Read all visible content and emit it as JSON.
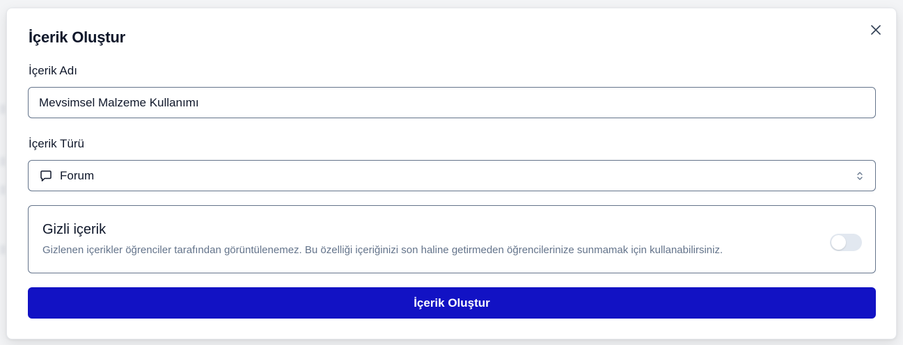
{
  "modal": {
    "title": "İçerik Oluştur",
    "close_icon": "close-icon"
  },
  "form": {
    "name_label": "İçerik Adı",
    "name_value": "Mevsimsel Malzeme Kullanımı",
    "type_label": "İçerik Türü",
    "type_value": "Forum",
    "type_icon": "message-square-icon",
    "type_chevron_icon": "chevrons-up-down-icon"
  },
  "hidden_content": {
    "title": "Gizli içerik",
    "description": "Gizlenen içerikler öğrenciler tarafından görüntülenemez. Bu özelliği içeriğinizi son haline getirmeden öğrencilerinize sunmamak için kullanabilirsiniz.",
    "enabled": false
  },
  "submit": {
    "label": "İçerik Oluştur"
  },
  "colors": {
    "primary": "#1212c4",
    "border": "#64748b",
    "muted_text": "#64748b",
    "toggle_off": "#e2e8f0"
  }
}
